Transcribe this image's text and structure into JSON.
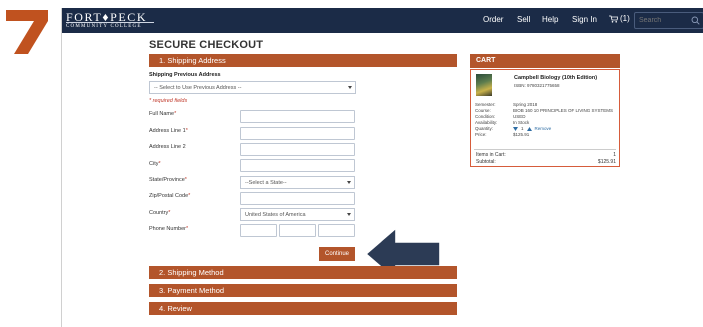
{
  "step_badge": {
    "number": "7",
    "color": "#c0521f"
  },
  "brand": {
    "name_top": "FORT♦PECK",
    "name_bottom": "COMMUNITY COLLEGE"
  },
  "nav": {
    "links": [
      "Order",
      "Sell",
      "Help",
      "Sign In"
    ],
    "cart_count": "(1)",
    "search_placeholder": "Search",
    "search_icon": "search-icon",
    "cart_icon": "cart-icon"
  },
  "page_title": "SECURE CHECKOUT",
  "colors": {
    "accent": "#b3552b",
    "navbar": "#1b2b47",
    "required": "#c0392b",
    "arrow": "#2c3b55"
  },
  "shipping": {
    "section_label": "1. Shipping Address",
    "previous_label": "Shipping Previous Address",
    "previous_select": "-- Select to Use Previous Address --",
    "required_note": "* required fields",
    "fields": {
      "full_name": {
        "label": "Full Name",
        "required": "*"
      },
      "address1": {
        "label": "Address Line 1",
        "required": "*"
      },
      "address2": {
        "label": "Address Line 2",
        "required": ""
      },
      "city": {
        "label": "City",
        "required": "*"
      },
      "state": {
        "label": "State/Province",
        "required": "*",
        "value": "--Select a State--"
      },
      "zip": {
        "label": "Zip/Postal Code",
        "required": "*"
      },
      "country": {
        "label": "Country",
        "required": "*",
        "value": "United States of America"
      },
      "phone": {
        "label": "Phone Number",
        "required": "*"
      }
    },
    "continue_label": "Continue"
  },
  "collapsed_sections": [
    "2. Shipping Method",
    "3. Payment Method",
    "4. Review"
  ],
  "cart": {
    "header": "CART",
    "book_title": "Campbell Biology (10th Edition)",
    "isbn": "ISBN: 9780321775658",
    "details": [
      {
        "key": "Semester:",
        "value": "Spring 2018"
      },
      {
        "key": "Course:",
        "value": "BIOB 160 10 PRINCIPLES OF LIVING SYSTEMS"
      },
      {
        "key": "Condition:",
        "value": "USED"
      },
      {
        "key": "Availability:",
        "value": "In Stock"
      }
    ],
    "quantity_label": "Quantity:",
    "quantity_value": "1",
    "remove_label": "Remove",
    "price_label": "Price:",
    "price_value": "$125.91",
    "items_label": "Items in Cart:",
    "items_value": "1",
    "subtotal_label": "Subtotal:",
    "subtotal_value": "$125.91"
  }
}
